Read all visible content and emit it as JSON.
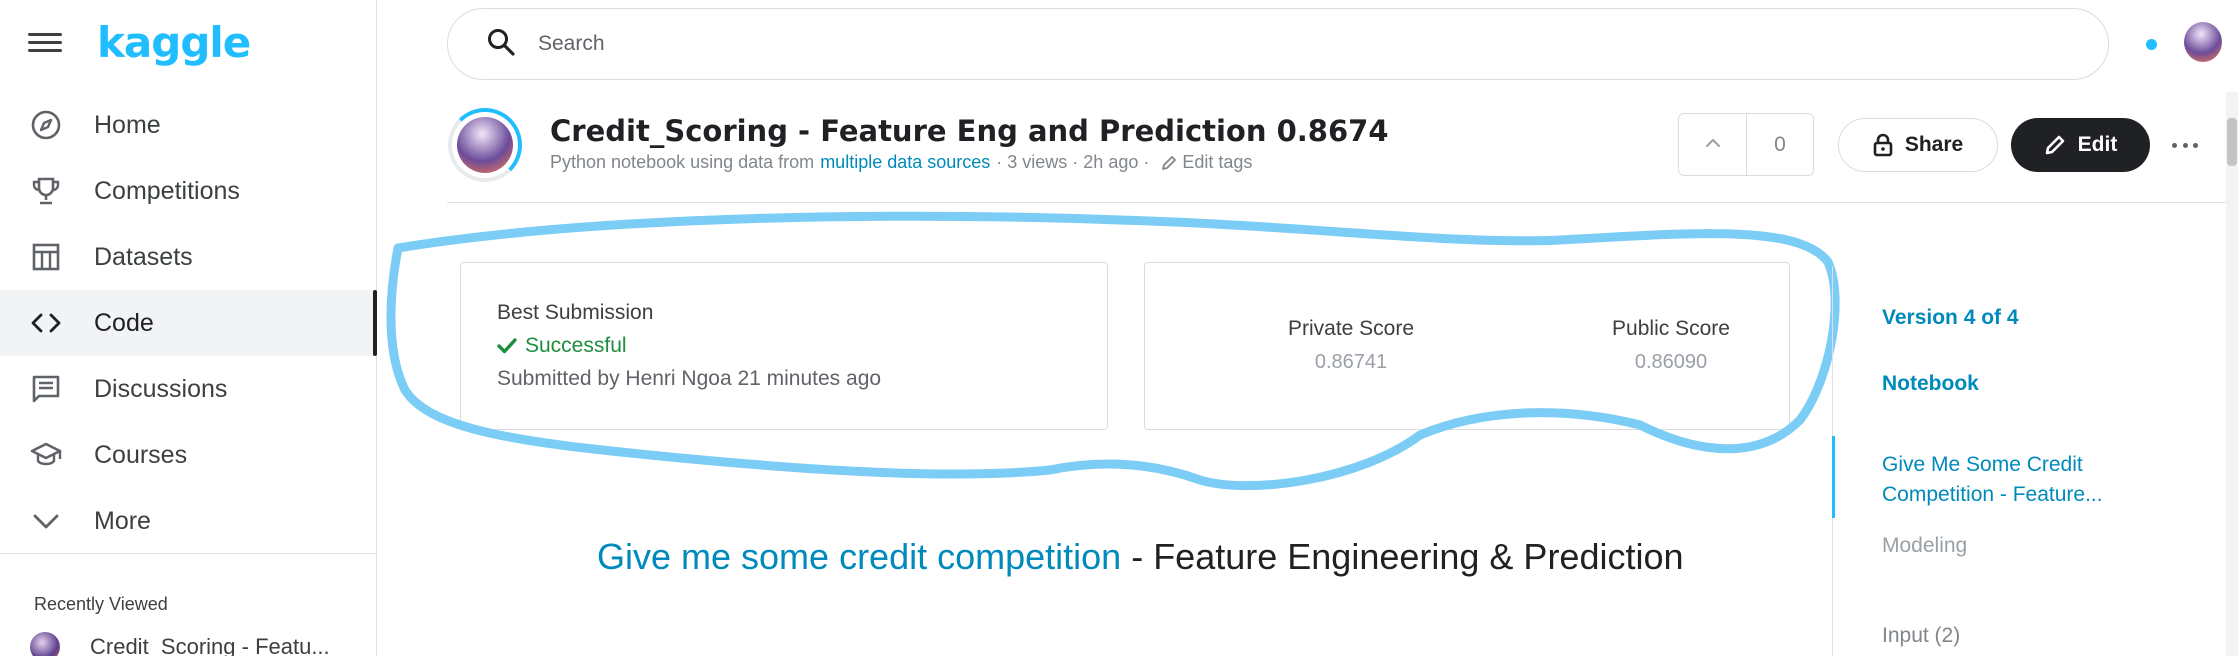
{
  "sidebar": {
    "logo": "kaggle",
    "items": [
      {
        "label": "Home",
        "icon": "compass-icon"
      },
      {
        "label": "Competitions",
        "icon": "trophy-icon"
      },
      {
        "label": "Datasets",
        "icon": "table-icon"
      },
      {
        "label": "Code",
        "icon": "code-icon",
        "active": true
      },
      {
        "label": "Discussions",
        "icon": "comment-icon"
      },
      {
        "label": "Courses",
        "icon": "school-icon"
      },
      {
        "label": "More",
        "icon": "chevron-down-icon"
      }
    ],
    "recently_viewed_title": "Recently Viewed",
    "recent_items": [
      {
        "label": "Credit_Scoring - Featu..."
      }
    ]
  },
  "search": {
    "placeholder": "Search"
  },
  "notebook": {
    "title": "Credit_Scoring - Feature Eng and Prediction 0.8674",
    "meta_prefix": "Python notebook using data from",
    "meta_link": "multiple data sources",
    "meta_views": "· 3 views · 2h ago ·",
    "edit_tags": "Edit tags",
    "votes": "0",
    "share_label": "Share",
    "edit_label": "Edit"
  },
  "submission": {
    "title": "Best Submission",
    "status": "Successful",
    "submitted_by": "Submitted by Henri Ngoa 21 minutes ago",
    "private_label": "Private Score",
    "private_value": "0.86741",
    "public_label": "Public Score",
    "public_value": "0.86090"
  },
  "toc": {
    "version": "Version 4 of 4",
    "notebook": "Notebook",
    "section": "Give Me Some Credit Competition - Feature...",
    "modeling": "Modeling",
    "input": "Input (2)"
  },
  "main": {
    "heading_link": "Give me some credit competition",
    "heading_rest": " - Feature Engineering & Prediction"
  },
  "colors": {
    "accent": "#20beff",
    "link": "#008abc",
    "success": "#1e8e3e",
    "annotation": "#7ccdf5"
  }
}
